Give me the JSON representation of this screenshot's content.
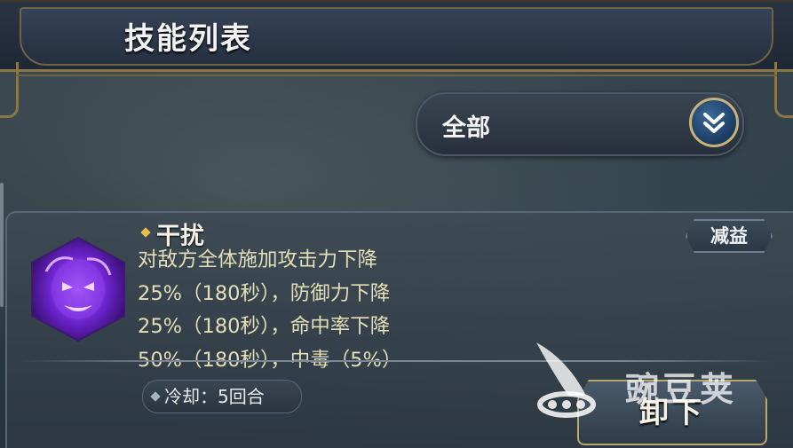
{
  "header": {
    "title": "技能列表"
  },
  "filter": {
    "selected": "全部"
  },
  "skill": {
    "name": "干扰",
    "tag": "减益",
    "description_lines": [
      "对敌方全体施加攻击力下降",
      "25%（180秒），防御力下降",
      "25%（180秒），命中率下降",
      "50%（180秒），中毒（5%）"
    ],
    "cooldown": "冷却：5回合",
    "unequip_label": "卸下"
  },
  "watermark": {
    "text": "豌豆荚"
  },
  "colors": {
    "frame_gold": "#8a7648",
    "desc_text": "#e5dfb8",
    "icon_purple": "#7a2bd6"
  }
}
